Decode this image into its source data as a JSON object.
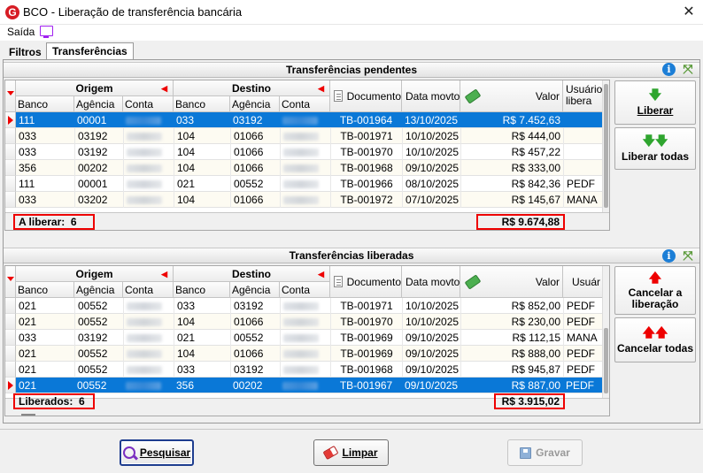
{
  "window": {
    "title": "BCO - Liberação de transferência bancária",
    "logo_letter": "G",
    "close_glyph": "✕"
  },
  "menu": {
    "saida": "Saída"
  },
  "tabs": [
    {
      "label": "Filtros"
    },
    {
      "label": "Transferências",
      "active": true
    }
  ],
  "pending": {
    "title": "Transferências pendentes",
    "group_origem": "Origem",
    "group_destino": "Destino",
    "columns": [
      "Banco",
      "Agência",
      "Conta",
      "Banco",
      "Agência",
      "Conta",
      "Documento",
      "Data movto",
      "Valor",
      "Usuário libera"
    ],
    "col_usuario": "Usuário",
    "col_usuario2": "libera",
    "rows": [
      {
        "ob": "111",
        "oa": "00001",
        "db": "033",
        "da": "03192",
        "doc": "TB-001964",
        "date": "13/10/2025",
        "valor": "R$ 7.452,63",
        "user": ""
      },
      {
        "ob": "033",
        "oa": "03192",
        "db": "104",
        "da": "01066",
        "doc": "TB-001971",
        "date": "10/10/2025",
        "valor": "R$ 444,00",
        "user": ""
      },
      {
        "ob": "033",
        "oa": "03192",
        "db": "104",
        "da": "01066",
        "doc": "TB-001970",
        "date": "10/10/2025",
        "valor": "R$ 457,22",
        "user": ""
      },
      {
        "ob": "356",
        "oa": "00202",
        "db": "104",
        "da": "01066",
        "doc": "TB-001968",
        "date": "09/10/2025",
        "valor": "R$ 333,00",
        "user": ""
      },
      {
        "ob": "111",
        "oa": "00001",
        "db": "021",
        "da": "00552",
        "doc": "TB-001966",
        "date": "08/10/2025",
        "valor": "R$ 842,36",
        "user": "PEDF"
      },
      {
        "ob": "033",
        "oa": "03202",
        "db": "104",
        "da": "01066",
        "doc": "TB-001972",
        "date": "07/10/2025",
        "valor": "R$ 145,67",
        "user": "MANA"
      }
    ],
    "count_label": "A liberar:",
    "count": "6",
    "total": "R$ 9.674,88"
  },
  "released": {
    "title": "Transferências liberadas",
    "group_origem": "Origem",
    "group_destino": "Destino",
    "columns": [
      "Banco",
      "Agência",
      "Conta",
      "Banco",
      "Agência",
      "Conta",
      "Documento",
      "Data movto",
      "Valor",
      "Usuár"
    ],
    "rows": [
      {
        "ob": "021",
        "oa": "00552",
        "db": "033",
        "da": "03192",
        "doc": "TB-001971",
        "date": "10/10/2025",
        "valor": "R$ 852,00",
        "user": "PEDF"
      },
      {
        "ob": "021",
        "oa": "00552",
        "db": "104",
        "da": "01066",
        "doc": "TB-001970",
        "date": "10/10/2025",
        "valor": "R$ 230,00",
        "user": "PEDF"
      },
      {
        "ob": "033",
        "oa": "03192",
        "db": "021",
        "da": "00552",
        "doc": "TB-001969",
        "date": "09/10/2025",
        "valor": "R$ 112,15",
        "user": "MANA"
      },
      {
        "ob": "021",
        "oa": "00552",
        "db": "104",
        "da": "01066",
        "doc": "TB-001969",
        "date": "09/10/2025",
        "valor": "R$ 888,00",
        "user": "PEDF"
      },
      {
        "ob": "021",
        "oa": "00552",
        "db": "033",
        "da": "03192",
        "doc": "TB-001968",
        "date": "09/10/2025",
        "valor": "R$ 945,87",
        "user": "PEDF"
      },
      {
        "ob": "021",
        "oa": "00552",
        "db": "356",
        "da": "00202",
        "doc": "TB-001967",
        "date": "09/10/2025",
        "valor": "R$ 887,00",
        "user": "PEDF"
      }
    ],
    "count_label": "Liberados:",
    "count": "6",
    "total": "R$ 3.915,02"
  },
  "side": {
    "liberar": "Liberar",
    "liberar_todas": "Liberar todas",
    "cancelar_a": "Cancelar a",
    "liberacao": "liberação",
    "cancelar_todas": "Cancelar todas"
  },
  "buttons": {
    "pesquisar": "Pesquisar",
    "limpar": "Limpar",
    "gravar": "Gravar"
  },
  "colors": {
    "selection": "#0a78d7",
    "highlight": "#e00000",
    "info": "#1c7ed6"
  }
}
